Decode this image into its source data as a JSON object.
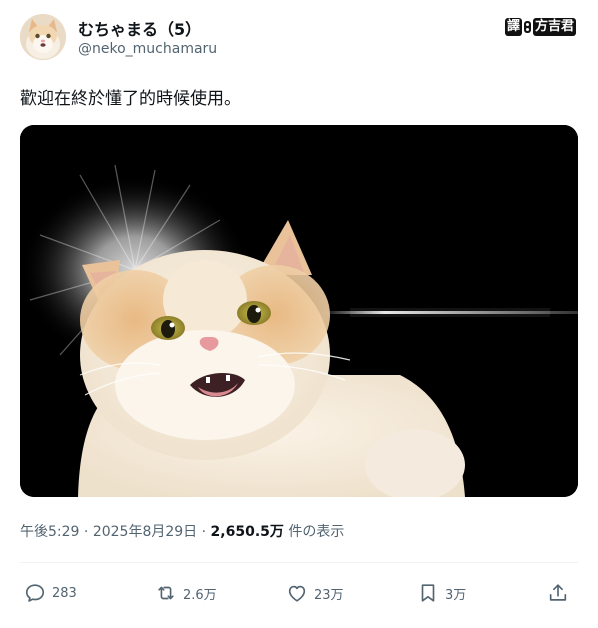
{
  "author": {
    "display_name": "むちゃまる（5）",
    "handle": "@neko_muchamaru"
  },
  "translator_mark": {
    "left": "譯",
    "right": "方吉君"
  },
  "tweet": {
    "text": "歡迎在終於懂了的時候使用。"
  },
  "meta": {
    "time": "午後5:29",
    "sep1": " · ",
    "date": "2025年8月29日",
    "sep2": " · ",
    "views_count": "2,650.5万",
    "views_label": " 件の表示"
  },
  "actions": {
    "reply_count": "283",
    "retweet_count": "2.6万",
    "like_count": "23万",
    "bookmark_count": "3万"
  },
  "icons": {
    "reply": "reply-icon",
    "retweet": "retweet-icon",
    "like": "heart-icon",
    "bookmark": "bookmark-icon",
    "share": "share-icon"
  },
  "colors": {
    "text_primary": "#0f1419",
    "text_secondary": "#536471",
    "divider": "#eff3f4",
    "media_background": "#000000"
  }
}
